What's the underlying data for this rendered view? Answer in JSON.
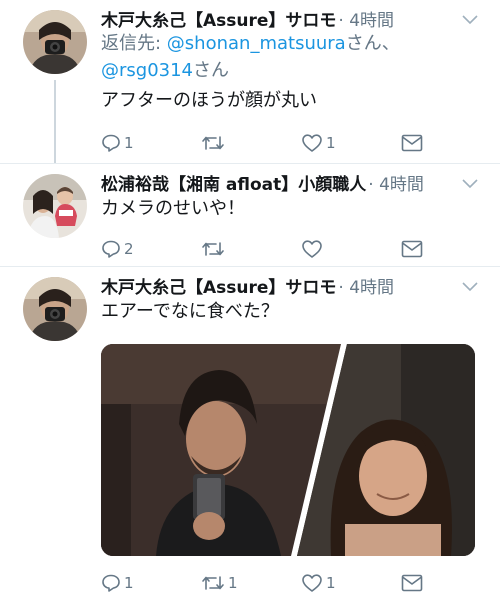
{
  "tweets": [
    {
      "name": "木戸大糸己【Assure】サロモ",
      "time": "· 4時間",
      "reply_prefix": "返信先: ",
      "mention1": "@shonan_matsuura",
      "san1": "さん、",
      "mention2": "@rsg0314",
      "san2": "さん",
      "text": "アフターのほうが顔が丸い",
      "reply_count": "1",
      "retweet_count": "",
      "like_count": "1"
    },
    {
      "name": "松浦裕哉【湘南 afloat】小顔職人",
      "time": "· 4時間",
      "text": "カメラのせいや！",
      "reply_count": "2",
      "retweet_count": "",
      "like_count": ""
    },
    {
      "name": "木戸大糸己【Assure】サロモ",
      "time": "· 4時間",
      "text": "エアーでなに食べた？",
      "reply_count": "1",
      "retweet_count": "1",
      "like_count": "1"
    }
  ],
  "icons": {
    "reply": "reply-icon",
    "retweet": "retweet-icon",
    "like": "heart-icon",
    "dm": "envelope-icon",
    "caret": "chevron-down-icon"
  },
  "colors": {
    "name": "#14171a",
    "secondary": "#657786",
    "link": "#1b95e0",
    "thread_line": "#cdd6dd",
    "divider": "#e6ecf0"
  }
}
